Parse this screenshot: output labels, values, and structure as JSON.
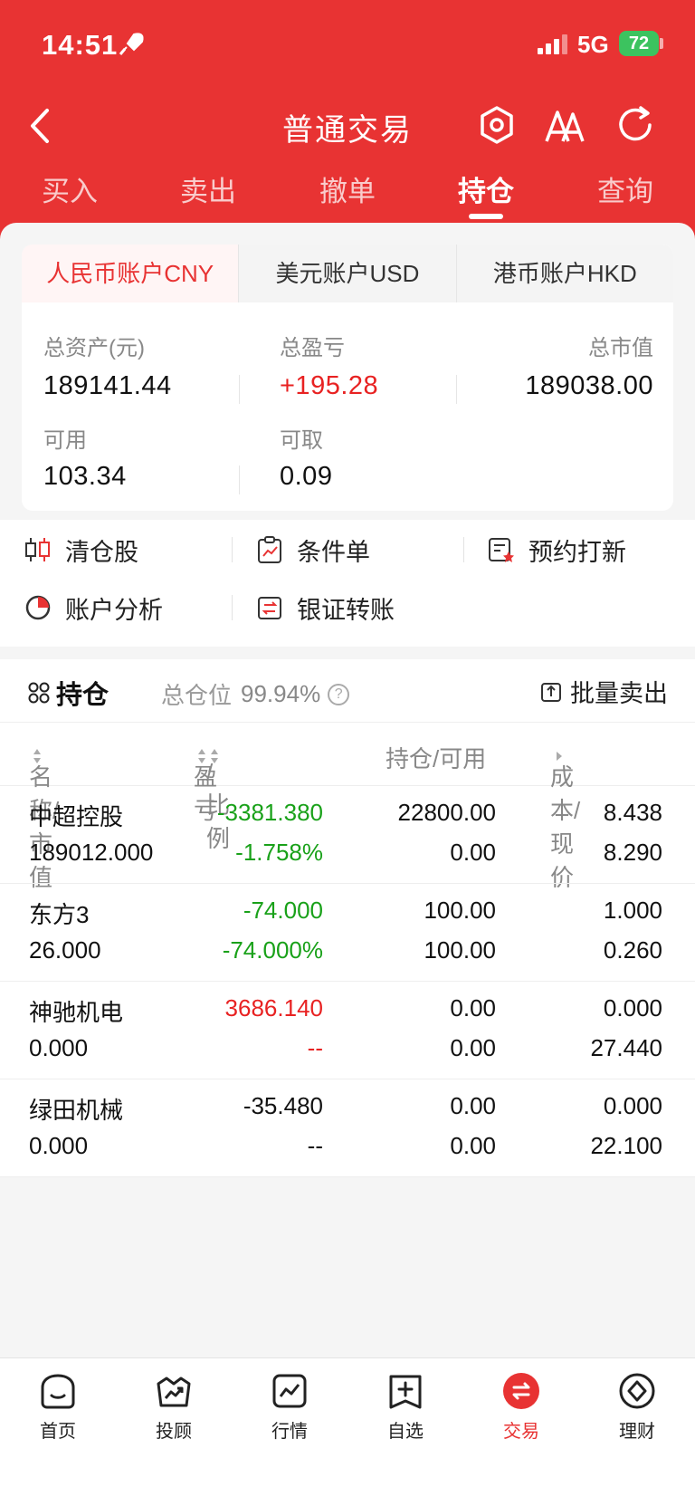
{
  "status_bar": {
    "time": "14:51",
    "network": "5G",
    "battery": "72"
  },
  "header": {
    "title": "普通交易"
  },
  "tabs": [
    {
      "label": "买入"
    },
    {
      "label": "卖出"
    },
    {
      "label": "撤单"
    },
    {
      "label": "持仓",
      "active": true
    },
    {
      "label": "查询"
    }
  ],
  "account_tabs": [
    {
      "label": "人民币账户CNY",
      "active": true
    },
    {
      "label": "美元账户USD"
    },
    {
      "label": "港币账户HKD"
    }
  ],
  "summary": {
    "total_assets_label": "总资产(元)",
    "total_assets": "189141.44",
    "total_pnl_label": "总盈亏",
    "total_pnl": "+195.28",
    "market_value_label": "总市值",
    "market_value": "189038.00",
    "available_label": "可用",
    "available": "103.34",
    "withdrawable_label": "可取",
    "withdrawable": "0.09"
  },
  "actions": [
    {
      "label": "清仓股",
      "icon": "candlestick-icon"
    },
    {
      "label": "条件单",
      "icon": "clipboard-chart-icon"
    },
    {
      "label": "预约打新",
      "icon": "form-badge-icon"
    },
    {
      "label": "账户分析",
      "icon": "pie-chart-icon"
    },
    {
      "label": "银证转账",
      "icon": "transfer-icon"
    }
  ],
  "holdings": {
    "title": "持仓",
    "total_position_label": "总仓位",
    "total_position": "99.94%",
    "batch_sell": "批量卖出",
    "columns": [
      "名称/市值",
      "盈亏",
      "/比例",
      "持仓/可用",
      "成本/现价"
    ],
    "rows": [
      {
        "name": "中超控股",
        "market_value": "189012.000",
        "pnl": "-3381.380",
        "ratio": "-1.758%",
        "position": "22800.00",
        "available": "0.00",
        "cost": "8.438",
        "price": "8.290",
        "pnl_color": "green",
        "ratio_color": "green"
      },
      {
        "name": "东方3",
        "market_value": "26.000",
        "pnl": "-74.000",
        "ratio": "-74.000%",
        "position": "100.00",
        "available": "100.00",
        "cost": "1.000",
        "price": "0.260",
        "pnl_color": "green",
        "ratio_color": "green"
      },
      {
        "name": "神驰机电",
        "market_value": "0.000",
        "pnl": "3686.140",
        "ratio": "--",
        "position": "0.00",
        "available": "0.00",
        "cost": "0.000",
        "price": "27.440",
        "pnl_color": "red",
        "ratio_color": "red"
      },
      {
        "name": "绿田机械",
        "market_value": "0.000",
        "pnl": "-35.480",
        "ratio": "--",
        "position": "0.00",
        "available": "0.00",
        "cost": "0.000",
        "price": "22.100",
        "pnl_color": "dark",
        "ratio_color": "dark"
      }
    ]
  },
  "bottom_nav": [
    {
      "label": "首页",
      "icon": "home-icon"
    },
    {
      "label": "投顾",
      "icon": "advisor-icon"
    },
    {
      "label": "行情",
      "icon": "market-icon"
    },
    {
      "label": "自选",
      "icon": "watchlist-icon"
    },
    {
      "label": "交易",
      "icon": "trade-icon",
      "active": true
    },
    {
      "label": "理财",
      "icon": "finance-icon"
    }
  ],
  "colors": {
    "brand_red": "#e83333",
    "gain_red": "#e82222",
    "loss_green": "#19a119"
  }
}
